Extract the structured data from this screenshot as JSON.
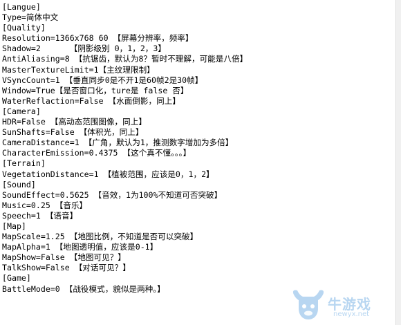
{
  "lines": [
    "[Langue]",
    "Type=简体中文",
    "[Quality]",
    "Resolution=1366x768 60 【屏幕分辨率，频率】",
    "Shadow=2      【阴影级别 0，1，2，3】",
    "AntiAliasing=8 【抗锯齿，默认为8？暂时不理解，可能是八倍】",
    "MasterTextureLimit=1【主纹理限制】",
    "VSyncCount=1 【垂直同步0是不开1是60帧2是30帧】",
    "Window=True【是否窗口化，ture是 false 否】",
    "WaterReflaction=False 【水面倒影，同上】",
    "[Camera]",
    "HDR=False 【高动态范围图像，同上】",
    "SunShafts=False 【体积光，同上】",
    "CameraDistance=1 【广角，默认为1，推测数字增加为多倍】",
    "CharacterEmission=0.4375 【这个真不懂。。。】",
    "[Terrain]",
    "VegetationDistance=1 【植被范围，应该是0，1，2】",
    "[Sound]",
    "SoundEffect=0.5625 【音效，1为100%不知道可否突破】",
    "Music=0.25 【音乐】",
    "Speech=1 【语音】",
    "[Map]",
    "MapScale=1.25 【地图比例，不知道是否可以突破】",
    "MapAlpha=1 【地图透明值，应该是0-1】",
    "MapShow=False 【地图可见？】",
    "TalkShow=False 【对话可见？】",
    "[Game]",
    "BattleMode=0 【战役模式，貌似是两种。】"
  ],
  "watermark": {
    "brand_text": "牛游戏",
    "url_text": "newyx.net",
    "color": "#7fb6e6",
    "icon": "bull-head-logo-icon"
  }
}
